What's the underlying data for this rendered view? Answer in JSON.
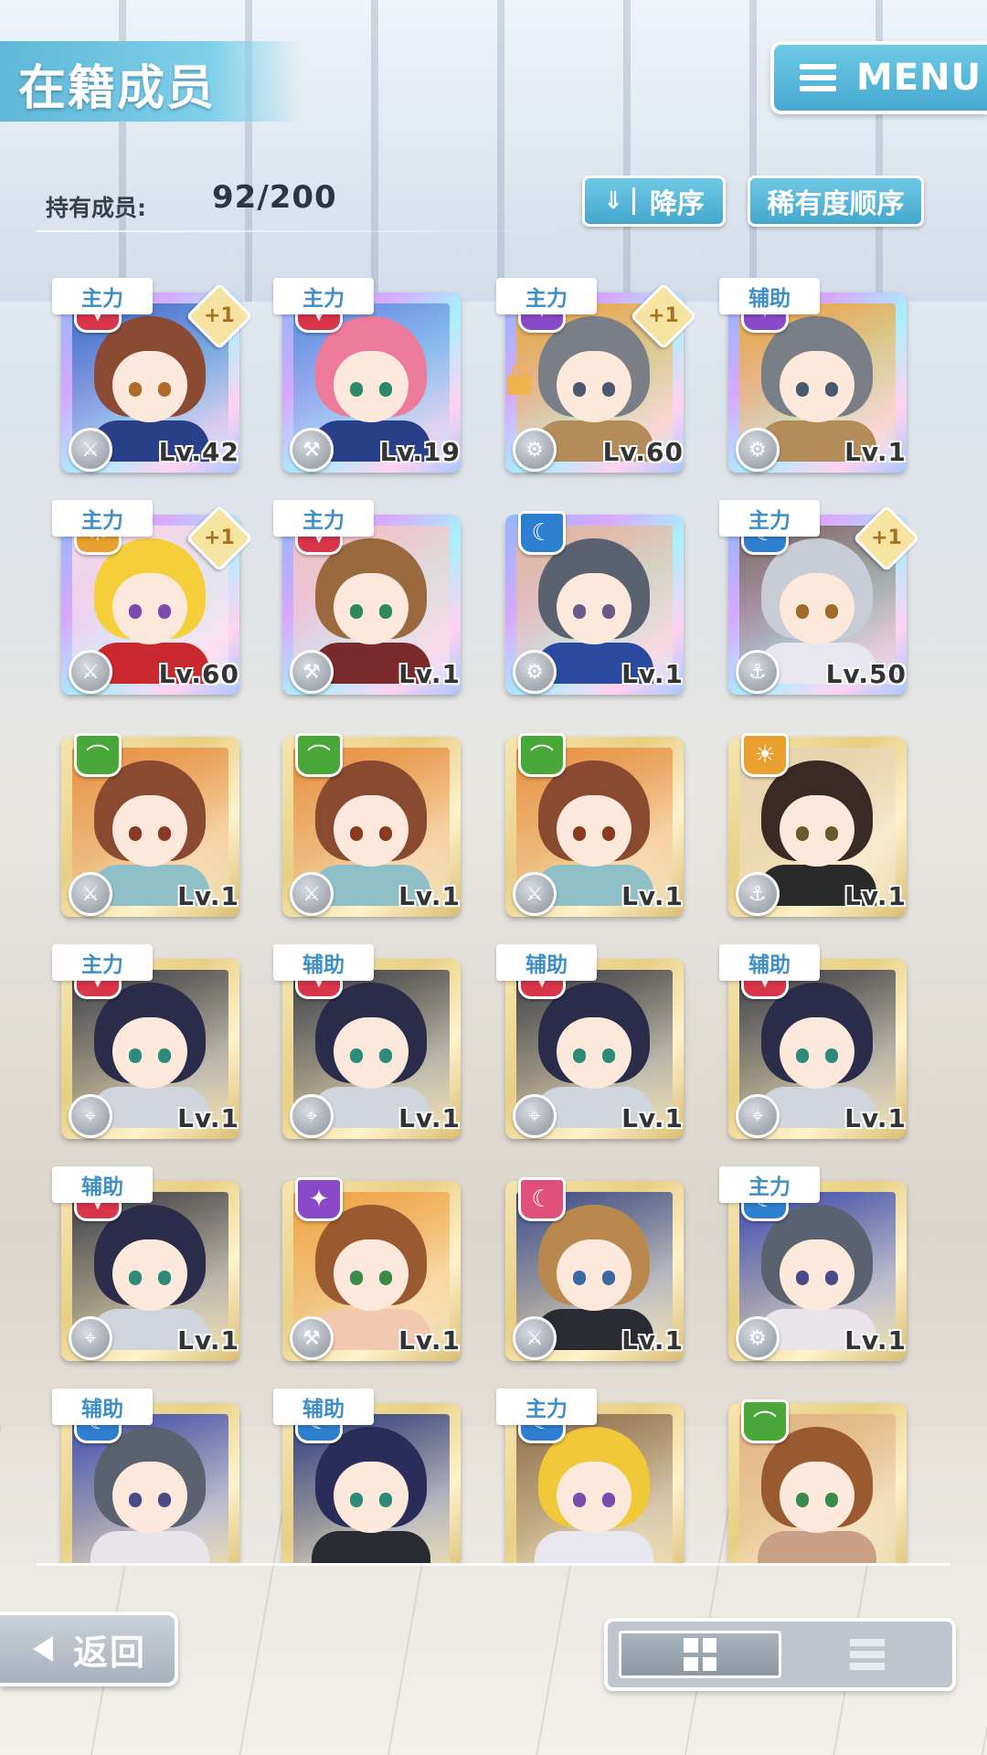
{
  "header": {
    "title": "在籍成员",
    "menu_label": "MENU",
    "menu_icon": "hamburger-icon"
  },
  "member_count": {
    "label": "持有成员:",
    "value": "92/200"
  },
  "sort": {
    "order_label": "降序",
    "order_icon": "chevron-double-down-icon",
    "rarity_label": "稀有度顺序"
  },
  "colors": {
    "accent": "#5ab8dc",
    "role_text": "#3f8fc6"
  },
  "cards": [
    {
      "role": "主力",
      "attr": "red",
      "plus": "+1",
      "lock": false,
      "frame": "rainbow",
      "weapon": "sword-icon",
      "level": "Lv.42",
      "hair": "#8a4a34",
      "eye": "#b06a2c",
      "outfit": "#2a3f8a",
      "bg": "#3a6fc8"
    },
    {
      "role": "主力",
      "attr": "red",
      "plus": "",
      "lock": false,
      "frame": "rainbow",
      "weapon": "hammer-icon",
      "level": "Lv.19",
      "hair": "#ee7a9b",
      "eye": "#2c8a6c",
      "outfit": "#2a3f8a",
      "bg": "#5a8fe0"
    },
    {
      "role": "主力",
      "attr": "purple",
      "plus": "+1",
      "lock": true,
      "frame": "rainbow",
      "weapon": "gear-icon",
      "level": "Lv.60",
      "hair": "#7a7e86",
      "eye": "#4a5870",
      "outfit": "#b48c5a",
      "bg": "#e8a83c"
    },
    {
      "role": "辅助",
      "attr": "purple",
      "plus": "",
      "lock": false,
      "frame": "rainbow",
      "weapon": "gear-icon",
      "level": "Lv.1",
      "hair": "#7a7e86",
      "eye": "#4a5870",
      "outfit": "#b48c5a",
      "bg": "#e8a83c"
    },
    {
      "role": "主力",
      "attr": "orange",
      "plus": "+1",
      "lock": false,
      "frame": "rainbow",
      "weapon": "sword-icon",
      "level": "Lv.60",
      "hair": "#f5cf3a",
      "eye": "#7c4ab0",
      "outfit": "#c8282e",
      "bg": "#f7d9e3"
    },
    {
      "role": "主力",
      "attr": "red",
      "plus": "",
      "lock": false,
      "frame": "rainbow",
      "weapon": "hammer-icon",
      "level": "Lv.1",
      "hair": "#9a6a3e",
      "eye": "#2c8a5a",
      "outfit": "#7a2a2a",
      "bg": "#f0c4c0"
    },
    {
      "role": "",
      "attr": "blue",
      "plus": "",
      "lock": false,
      "frame": "rainbow",
      "weapon": "gear-icon",
      "level": "Lv.1",
      "hair": "#5a6270",
      "eye": "#6a5a8a",
      "outfit": "#2a4aa0",
      "bg": "#e0b898"
    },
    {
      "role": "主力",
      "attr": "blue",
      "plus": "+1",
      "lock": false,
      "frame": "rainbow",
      "weapon": "hook-icon",
      "level": "Lv.50",
      "hair": "#c8ccd6",
      "eye": "#a06a2a",
      "outfit": "#e8e6ee",
      "bg": "#7a6a60"
    },
    {
      "role": "",
      "attr": "green",
      "plus": "",
      "lock": false,
      "frame": "gold",
      "weapon": "sword-icon",
      "level": "Lv.1",
      "hair": "#8a4a30",
      "eye": "#8a3a20",
      "outfit": "#8fc0c8",
      "bg": "#e88c3c"
    },
    {
      "role": "",
      "attr": "green",
      "plus": "",
      "lock": false,
      "frame": "gold",
      "weapon": "sword-icon",
      "level": "Lv.1",
      "hair": "#8a4a30",
      "eye": "#8a3a20",
      "outfit": "#8fc0c8",
      "bg": "#e88c3c"
    },
    {
      "role": "",
      "attr": "green",
      "plus": "",
      "lock": false,
      "frame": "gold",
      "weapon": "sword-icon",
      "level": "Lv.1",
      "hair": "#8a4a30",
      "eye": "#8a3a20",
      "outfit": "#8fc0c8",
      "bg": "#e88c3c"
    },
    {
      "role": "",
      "attr": "orange",
      "plus": "",
      "lock": false,
      "frame": "gold",
      "weapon": "hook-icon",
      "level": "Lv.1",
      "hair": "#3a2a26",
      "eye": "#6a5a30",
      "outfit": "#2a2a2a",
      "bg": "#e8d0b0"
    },
    {
      "role": "主力",
      "attr": "red",
      "plus": "",
      "lock": false,
      "frame": "gold",
      "weapon": "gun-icon",
      "level": "Lv.1",
      "hair": "#2a2c4a",
      "eye": "#2c8a7a",
      "outfit": "#d0d4dc",
      "bg": "#3a3c48"
    },
    {
      "role": "辅助",
      "attr": "red",
      "plus": "",
      "lock": false,
      "frame": "gold",
      "weapon": "gun-icon",
      "level": "Lv.1",
      "hair": "#2a2c4a",
      "eye": "#2c8a7a",
      "outfit": "#d0d4dc",
      "bg": "#3a3c48"
    },
    {
      "role": "辅助",
      "attr": "red",
      "plus": "",
      "lock": false,
      "frame": "gold",
      "weapon": "gun-icon",
      "level": "Lv.1",
      "hair": "#2a2c4a",
      "eye": "#2c8a7a",
      "outfit": "#d0d4dc",
      "bg": "#3a3c48"
    },
    {
      "role": "辅助",
      "attr": "red",
      "plus": "",
      "lock": false,
      "frame": "gold",
      "weapon": "gun-icon",
      "level": "Lv.1",
      "hair": "#2a2c4a",
      "eye": "#2c8a7a",
      "outfit": "#d0d4dc",
      "bg": "#3a3c48"
    },
    {
      "role": "辅助",
      "attr": "red",
      "plus": "",
      "lock": false,
      "frame": "gold",
      "weapon": "gun-icon",
      "level": "Lv.1",
      "hair": "#2a2c4a",
      "eye": "#2c8a7a",
      "outfit": "#d0d4dc",
      "bg": "#3a3c48"
    },
    {
      "role": "",
      "attr": "purple",
      "plus": "",
      "lock": false,
      "frame": "gold",
      "weapon": "hammer-icon",
      "level": "Lv.1",
      "hair": "#9a5a30",
      "eye": "#3a8a4a",
      "outfit": "#f2c8b0",
      "bg": "#f0a040"
    },
    {
      "role": "",
      "attr": "pink",
      "plus": "",
      "lock": false,
      "frame": "gold",
      "weapon": "sword-icon",
      "level": "Lv.1",
      "hair": "#b8884e",
      "eye": "#3a6aa0",
      "outfit": "#2a2a32",
      "bg": "#3a4a8a"
    },
    {
      "role": "主力",
      "attr": "blue",
      "plus": "",
      "lock": false,
      "frame": "gold",
      "weapon": "gear-icon",
      "level": "Lv.1",
      "hair": "#5a6270",
      "eye": "#4a4a8a",
      "outfit": "#e8e4ea",
      "bg": "#3a4ab0"
    },
    {
      "role": "辅助",
      "attr": "blue",
      "plus": "",
      "lock": false,
      "frame": "gold",
      "weapon": "",
      "level": "",
      "hair": "#5a6270",
      "eye": "#4a4a8a",
      "outfit": "#e8e4ea",
      "bg": "#3a4ab0"
    },
    {
      "role": "辅助",
      "attr": "blue",
      "plus": "",
      "lock": false,
      "frame": "gold",
      "weapon": "",
      "level": "",
      "hair": "#2a2c5a",
      "eye": "#2c8a7a",
      "outfit": "#2a2a32",
      "bg": "#2a3a80"
    },
    {
      "role": "主力",
      "attr": "blue",
      "plus": "",
      "lock": false,
      "frame": "gold",
      "weapon": "",
      "level": "",
      "hair": "#f0c83a",
      "eye": "#7a4ab0",
      "outfit": "#e8e6ee",
      "bg": "#8a6a4a"
    },
    {
      "role": "",
      "attr": "green",
      "plus": "",
      "lock": false,
      "frame": "gold",
      "weapon": "",
      "level": "",
      "hair": "#9a5a30",
      "eye": "#3a8a4a",
      "outfit": "#c8a088",
      "bg": "#e0b080"
    }
  ],
  "footer": {
    "back_label": "返回",
    "back_icon": "arrow-left-icon",
    "grid_view_icon": "grid-view-icon",
    "list_view_icon": "list-view-icon"
  }
}
